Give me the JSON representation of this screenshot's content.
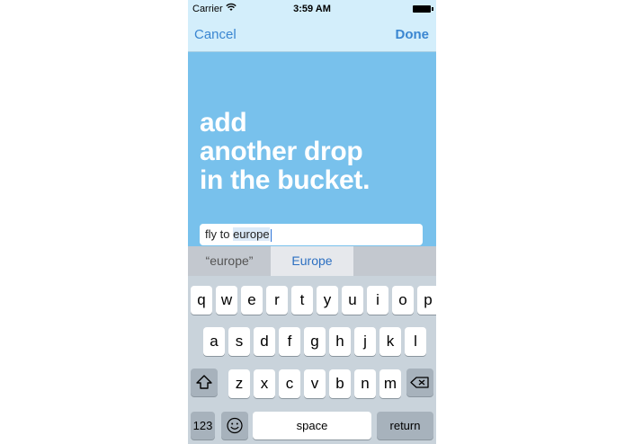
{
  "status_bar": {
    "carrier": "Carrier",
    "time": "3:59 AM",
    "wifi_icon": "wifi-icon",
    "battery_icon": "battery-icon"
  },
  "nav_bar": {
    "cancel_label": "Cancel",
    "done_label": "Done"
  },
  "headline": {
    "line1": "add",
    "line2": "another drop",
    "line3": "in the bucket."
  },
  "text_field": {
    "prefix": "fly to ",
    "marked_text": "europe"
  },
  "suggestions": {
    "item1": "“europe”",
    "item2": "Europe",
    "item3": ""
  },
  "keyboard": {
    "row1": [
      "q",
      "w",
      "e",
      "r",
      "t",
      "y",
      "u",
      "i",
      "o",
      "p"
    ],
    "row2": [
      "a",
      "s",
      "d",
      "f",
      "g",
      "h",
      "j",
      "k",
      "l"
    ],
    "row3": [
      "z",
      "x",
      "c",
      "v",
      "b",
      "n",
      "m"
    ],
    "numbers_label": "123",
    "space_label": "space",
    "return_label": "return",
    "shift_icon": "shift-icon",
    "delete_icon": "delete-icon",
    "emoji_icon": "emoji-icon"
  },
  "colors": {
    "background": "#78c1ec",
    "nav_bar": "#d3eefb",
    "tint": "#3a86d1",
    "keyboard": "#c9d3db"
  }
}
